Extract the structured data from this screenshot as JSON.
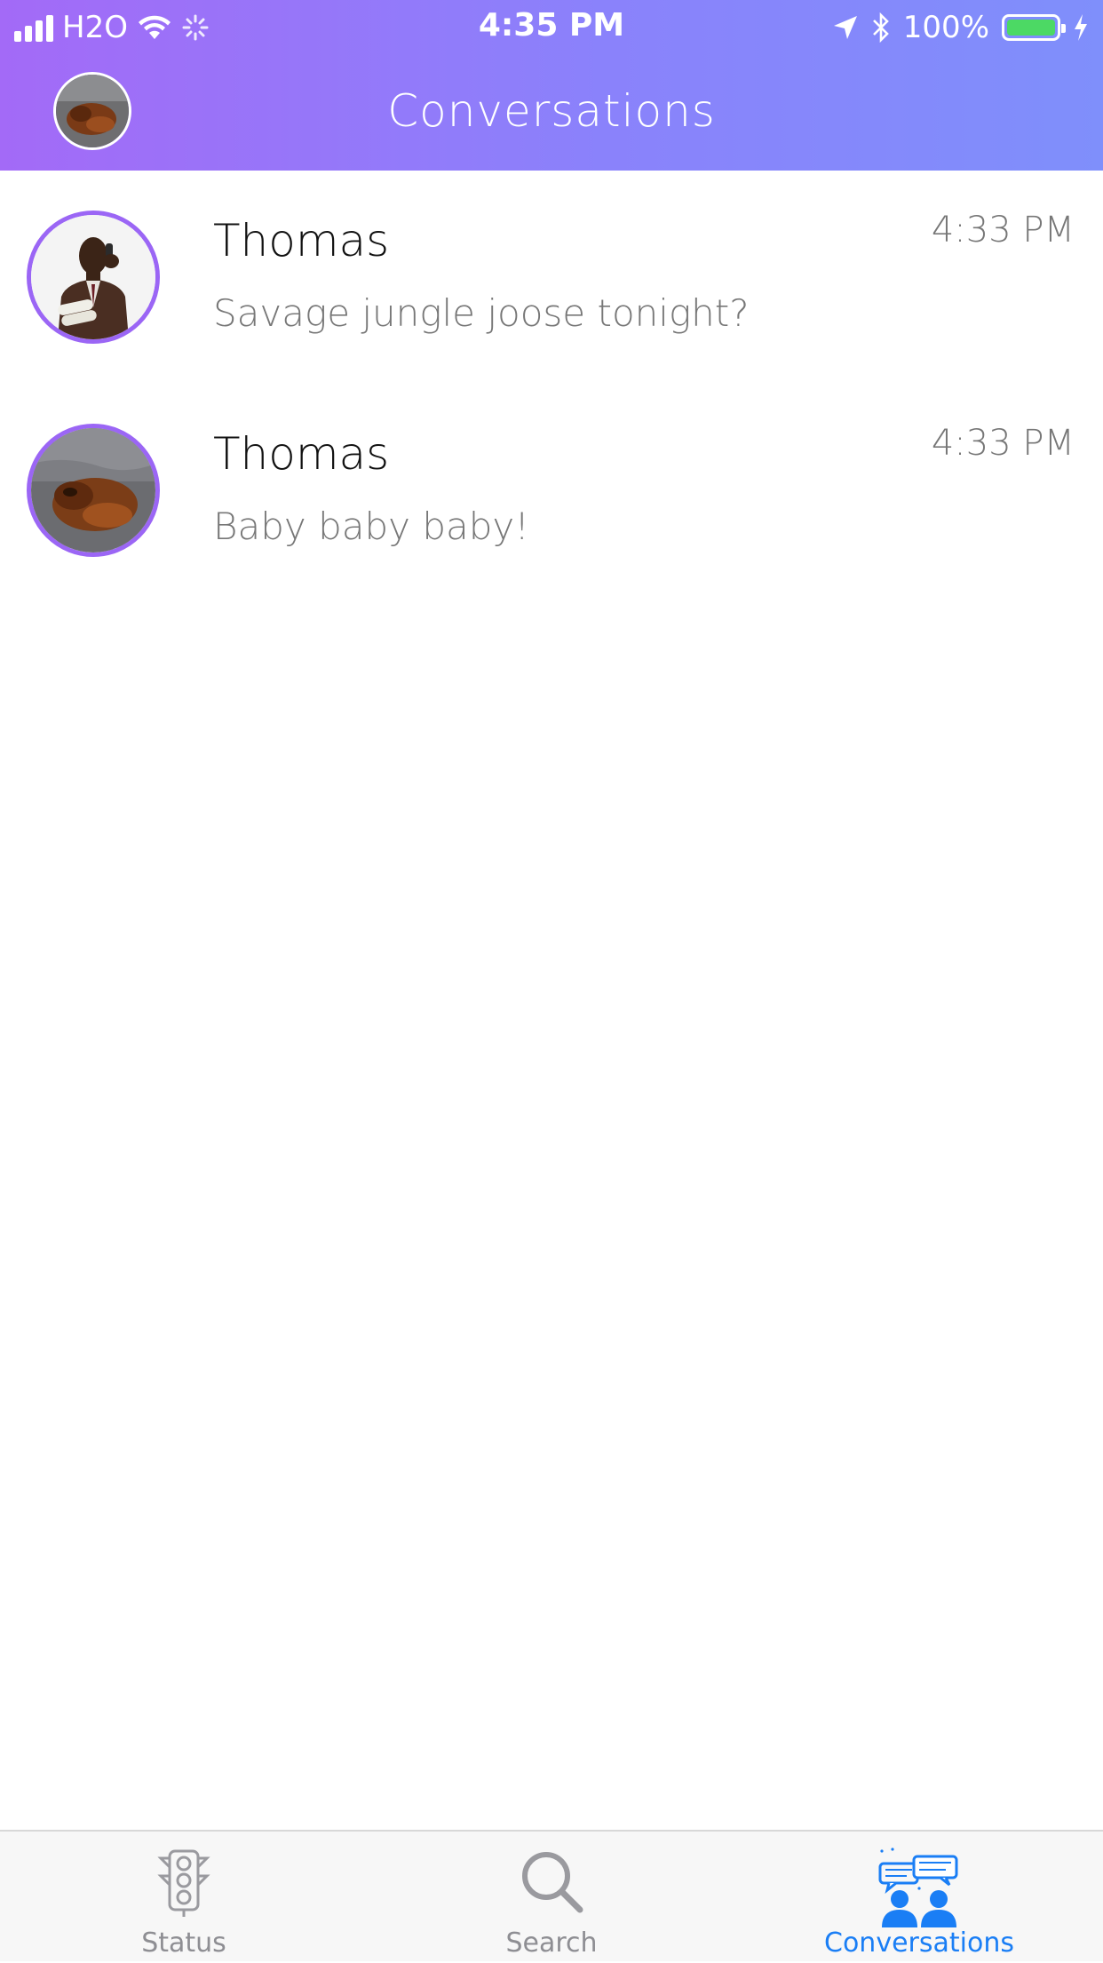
{
  "status_bar": {
    "carrier": "H2O",
    "time": "4:35 PM",
    "battery_percent": "100%"
  },
  "header": {
    "title": "Conversations"
  },
  "conversations": [
    {
      "name": "Thomas",
      "preview": "Savage jungle joose tonight?",
      "time": "4:33 PM",
      "avatar": "man-on-phone-photo"
    },
    {
      "name": "Thomas",
      "preview": "Baby baby baby!",
      "time": "4:33 PM",
      "avatar": "dog-sleeping-photo"
    }
  ],
  "tabs": [
    {
      "label": "Status",
      "icon": "traffic-light-icon",
      "active": false
    },
    {
      "label": "Search",
      "icon": "search-icon",
      "active": false
    },
    {
      "label": "Conversations",
      "icon": "conversations-icon",
      "active": true
    }
  ],
  "colors": {
    "header_gradient_start": "#a36af7",
    "header_gradient_end": "#7f8ffb",
    "avatar_ring": "#9b66f5",
    "active_tab": "#1a7ef5",
    "inactive_tab": "#8e8e93"
  }
}
